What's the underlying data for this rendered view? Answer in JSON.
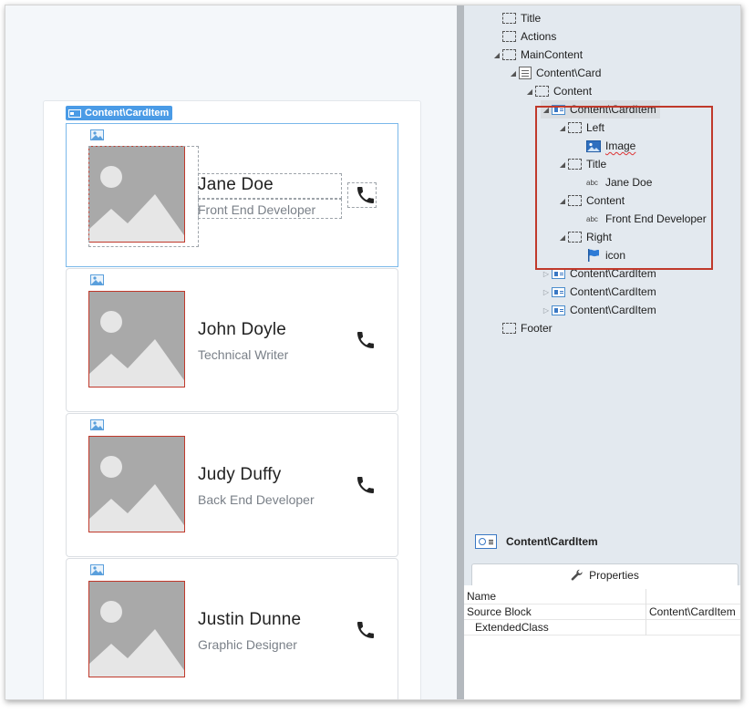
{
  "canvas": {
    "selected_tag": "Content\\CardItem",
    "cards": [
      {
        "name": "Jane Doe",
        "role": "Front End Developer",
        "selected": true
      },
      {
        "name": "John Doyle",
        "role": "Technical Writer",
        "selected": false
      },
      {
        "name": "Judy Duffy",
        "role": "Back End Developer",
        "selected": false
      },
      {
        "name": "Justin Dunne",
        "role": "Graphic Designer",
        "selected": false
      }
    ],
    "icons": {
      "placeholder": "image-placeholder-icon",
      "action": "phone-icon"
    }
  },
  "tree": {
    "items": [
      {
        "label": "Title",
        "icon": "placeholder-icon",
        "twisty": "none"
      },
      {
        "label": "Actions",
        "icon": "placeholder-icon",
        "twisty": "none"
      },
      {
        "label": "MainContent",
        "icon": "placeholder-icon",
        "twisty": "expanded"
      },
      {
        "label": "Content\\Card",
        "icon": "list-icon",
        "twisty": "expanded"
      },
      {
        "label": "Content",
        "icon": "placeholder-icon",
        "twisty": "expanded"
      },
      {
        "label": "Content\\CardItem",
        "icon": "block-icon",
        "twisty": "expanded",
        "selected": true
      },
      {
        "label": "Left",
        "icon": "placeholder-icon",
        "twisty": "expanded"
      },
      {
        "label": "Image",
        "icon": "image-icon",
        "twisty": "none"
      },
      {
        "label": "Title",
        "icon": "placeholder-icon",
        "twisty": "expanded"
      },
      {
        "label": "Jane Doe",
        "icon": "text-icon",
        "twisty": "none"
      },
      {
        "label": "Content",
        "icon": "placeholder-icon",
        "twisty": "expanded"
      },
      {
        "label": "Front End Developer",
        "icon": "text-icon",
        "twisty": "none"
      },
      {
        "label": "Right",
        "icon": "placeholder-icon",
        "twisty": "expanded"
      },
      {
        "label": "icon",
        "icon": "flag-icon",
        "twisty": "none"
      },
      {
        "label": "Content\\CardItem",
        "icon": "block-icon",
        "twisty": "collapsed"
      },
      {
        "label": "Content\\CardItem",
        "icon": "block-icon",
        "twisty": "collapsed"
      },
      {
        "label": "Content\\CardItem",
        "icon": "block-icon",
        "twisty": "collapsed"
      },
      {
        "label": "Footer",
        "icon": "placeholder-icon",
        "twisty": "none"
      }
    ],
    "text_prefix": "abc"
  },
  "properties": {
    "selected_element": "Content\\CardItem",
    "tab_label": "Properties",
    "rows": [
      {
        "name": "Name",
        "value": ""
      },
      {
        "name": "Source Block",
        "value": "Content\\CardItem"
      },
      {
        "name": "ExtendedClass",
        "value": ""
      }
    ]
  },
  "colors": {
    "highlight_red": "#c0392b",
    "selection_blue": "#4a9be6",
    "panel_bg": "#e3e9ef"
  }
}
